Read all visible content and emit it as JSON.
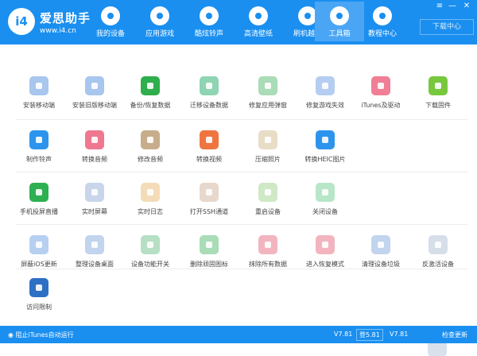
{
  "brand": {
    "name": "爱思助手",
    "url": "www.i4.cn",
    "logo_text": "i4"
  },
  "nav": [
    {
      "label": "我的设备",
      "icon": "apple-icon"
    },
    {
      "label": "应用游戏",
      "icon": "app-store-icon"
    },
    {
      "label": "酷炫铃声",
      "icon": "bell-icon"
    },
    {
      "label": "高清壁纸",
      "icon": "flower-icon"
    },
    {
      "label": "刷机越狱",
      "icon": "box-icon"
    },
    {
      "label": "工具箱",
      "icon": "tools-icon",
      "active": true
    },
    {
      "label": "教程中心",
      "icon": "info-icon"
    }
  ],
  "window_controls": {
    "menu": "≡",
    "minimize": "—",
    "close": "✕"
  },
  "download_center": "下载中心",
  "tools": [
    [
      {
        "label": "安装移动端",
        "color": "#a8c6ee",
        "icon": "i4-app-icon"
      },
      {
        "label": "安装旧版移动端",
        "color": "#a8c6ee",
        "icon": "i4-app-old-icon"
      },
      {
        "label": "备份/恢复数据",
        "color": "#2eae4c",
        "icon": "backup-restore-icon"
      },
      {
        "label": "迁移设备数据",
        "color": "#8fd4b3",
        "icon": "migrate-icon"
      },
      {
        "label": "修复应用弹窗",
        "color": "#a9dcb7",
        "icon": "fix-popup-icon"
      },
      {
        "label": "修复游戏失效",
        "color": "#b5cdf0",
        "icon": "fix-game-icon"
      },
      {
        "label": "iTunes及驱动",
        "color": "#f07f95",
        "icon": "itunes-icon"
      },
      {
        "label": "下载固件",
        "color": "#78c83e",
        "icon": "firmware-cube-icon"
      }
    ],
    [
      {
        "label": "制作铃声",
        "color": "#2d94ed",
        "icon": "ringtone-bell-icon"
      },
      {
        "label": "转换音频",
        "color": "#ef7890",
        "icon": "audio-note-icon"
      },
      {
        "label": "修改音频",
        "color": "#c8ad8c",
        "icon": "edit-audio-icon"
      },
      {
        "label": "转换视频",
        "color": "#ef7540",
        "icon": "video-play-icon"
      },
      {
        "label": "压缩照片",
        "color": "#e8ddc6",
        "icon": "photo-compress-icon"
      },
      {
        "label": "转换HEIC图片",
        "color": "#2d94ed",
        "icon": "heic-photo-icon"
      }
    ],
    [
      {
        "label": "手机投屏直播",
        "color": "#2db052",
        "icon": "screen-cast-icon"
      },
      {
        "label": "实时屏幕",
        "color": "#c8d5ea",
        "icon": "realtime-screen-icon"
      },
      {
        "label": "实时日志",
        "color": "#f4dcb8",
        "icon": "log-icon"
      },
      {
        "label": "打开SSH通道",
        "color": "#e6d8cc",
        "icon": "ssh-icon"
      },
      {
        "label": "重启设备",
        "color": "#cfe8c6",
        "icon": "restart-icon"
      },
      {
        "label": "关闭设备",
        "color": "#b8e6c8",
        "icon": "power-icon"
      }
    ],
    [
      {
        "label": "屏蔽iOS更新",
        "color": "#b7d0f2",
        "icon": "block-update-icon"
      },
      {
        "label": "整理设备桌面",
        "color": "#c2d4ee",
        "icon": "desktop-grid-icon"
      },
      {
        "label": "设备功能开关",
        "color": "#b6dfc4",
        "icon": "feature-toggle-icon"
      },
      {
        "label": "删除顽固图标",
        "color": "#a9dcb7",
        "icon": "delete-icon-icon"
      },
      {
        "label": "抹除所有数据",
        "color": "#f2b5c0",
        "icon": "erase-apple-icon"
      },
      {
        "label": "进入恢复模式",
        "color": "#f2b5c0",
        "icon": "recovery-icon"
      },
      {
        "label": "清理设备垃圾",
        "color": "#c2d4ee",
        "icon": "clean-broom-icon"
      },
      {
        "label": "反激活设备",
        "color": "#d6deea",
        "icon": "deactivate-icon"
      }
    ],
    [
      {
        "label": "访问限制",
        "color": "#2d6fc4",
        "icon": "restriction-icon"
      }
    ]
  ],
  "footer": {
    "itunes_block": "阻止iTunes自动运行",
    "version1": "V7.81",
    "version_box": "登5.81",
    "version2": "V7.81",
    "check_update": "检查更新"
  }
}
